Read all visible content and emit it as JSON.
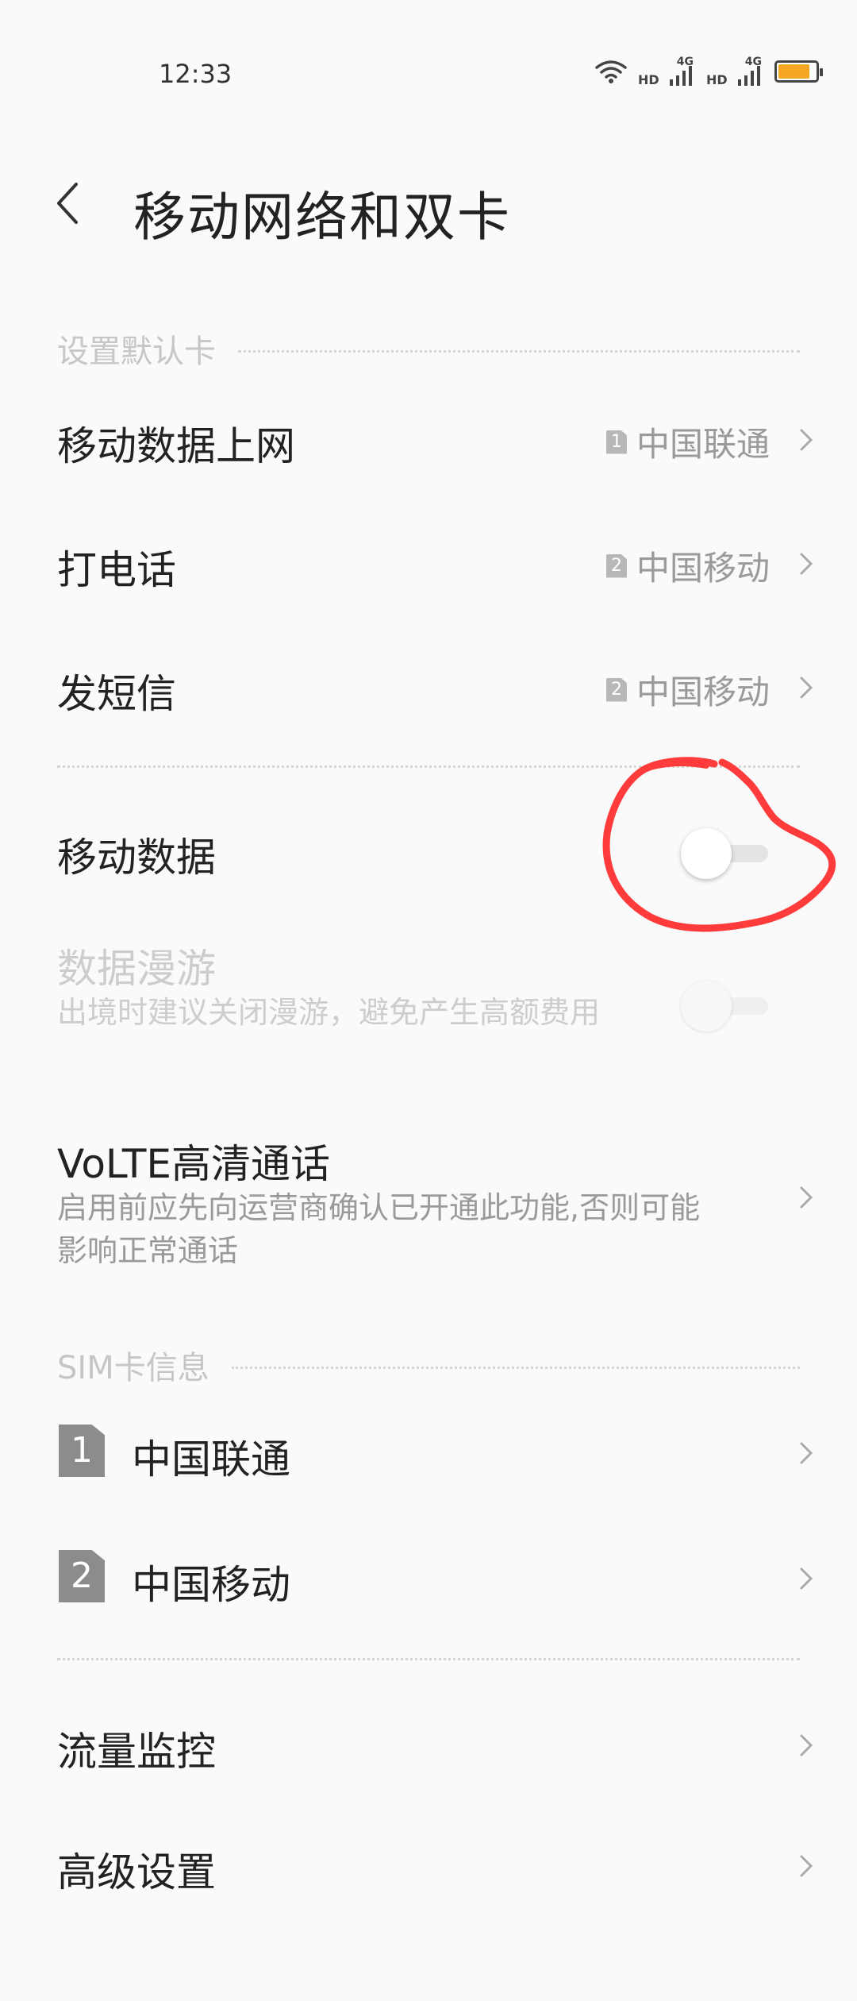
{
  "status_bar": {
    "time": "12:33",
    "hd_label": "HD",
    "net_label": "4G",
    "battery_color": "#f5a623",
    "battery_level": 0.85
  },
  "header": {
    "title": "移动网络和双卡"
  },
  "default_card_section": {
    "title": "设置默认卡",
    "items": [
      {
        "label": "移动数据上网",
        "sim": "1",
        "value": "中国联通"
      },
      {
        "label": "打电话",
        "sim": "2",
        "value": "中国移动"
      },
      {
        "label": "发短信",
        "sim": "2",
        "value": "中国移动"
      }
    ]
  },
  "mobile_data": {
    "label": "移动数据",
    "enabled": false
  },
  "data_roaming": {
    "label": "数据漫游",
    "desc": "出境时建议关闭漫游，避免产生高额费用",
    "enabled": false,
    "disabled": true
  },
  "volte": {
    "label": "VoLTE高清通话",
    "desc": "启用前应先向运营商确认已开通此功能,否则可能影响正常通话"
  },
  "sim_section": {
    "title": "SIM卡信息",
    "cards": [
      {
        "slot": "1",
        "name": "中国联通"
      },
      {
        "slot": "2",
        "name": "中国移动"
      }
    ]
  },
  "extra": {
    "traffic_monitor": "流量监控",
    "advanced": "高级设置"
  },
  "colors": {
    "annotation": "#ff3b3b",
    "section_title": "#c6c6c6",
    "value": "#9a9a9a"
  }
}
